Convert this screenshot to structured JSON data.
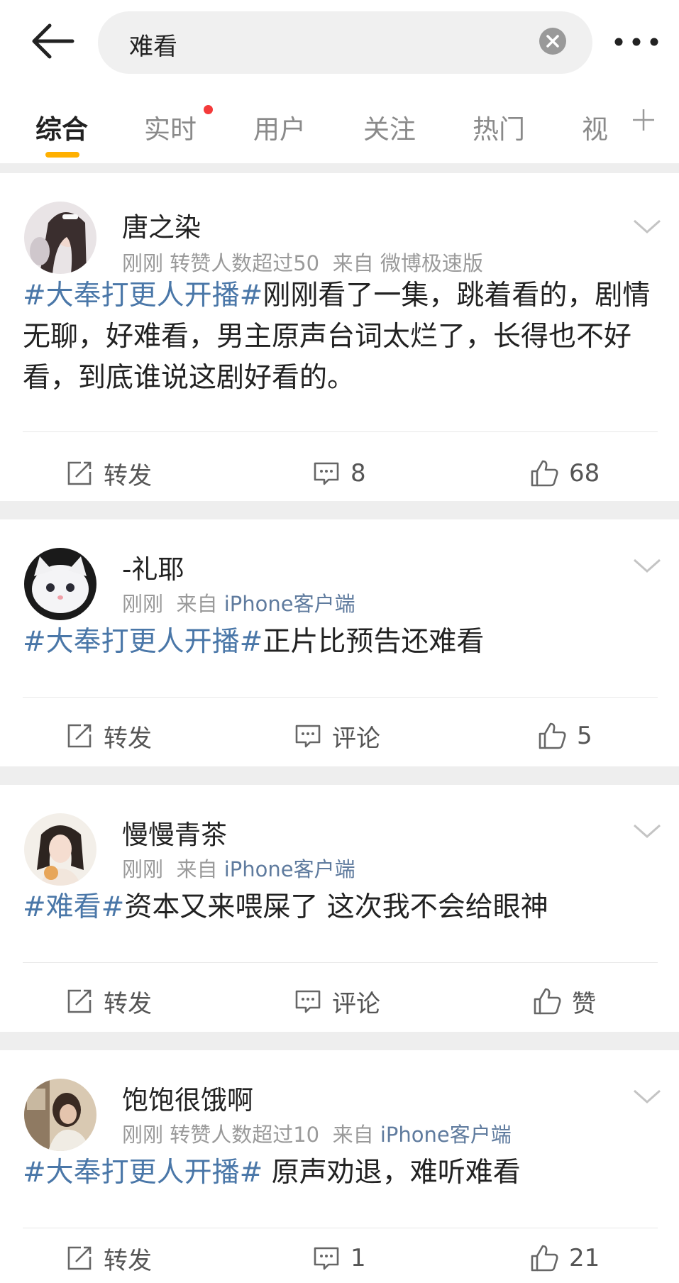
{
  "search": {
    "query": "难看"
  },
  "tabs": [
    {
      "label": "综合",
      "active": true
    },
    {
      "label": "实时",
      "has_dot": true
    },
    {
      "label": "用户"
    },
    {
      "label": "关注"
    },
    {
      "label": "热门"
    },
    {
      "label": "视"
    }
  ],
  "colors": {
    "accent": "#ffb000",
    "link": "#4a77a8",
    "dot": "#f43a3a"
  },
  "posts": [
    {
      "username": "唐之染",
      "time": "刚刚",
      "extra": "转赞人数超过50",
      "from_label": "来自",
      "source": "微博极速版",
      "tag": "#大奉打更人开播#",
      "text": "刚刚看了一集，跳着看的，剧情无聊，好难看，男主原声台词太烂了，长得也不好看，到底谁说这剧好看的。",
      "repost": "转发",
      "comment": "8",
      "like": "68"
    },
    {
      "username": "-礼耶",
      "time": "刚刚",
      "extra": "",
      "from_label": "来自",
      "source": "iPhone客户端",
      "tag": "#大奉打更人开播#",
      "text": "正片比预告还难看",
      "repost": "转发",
      "comment": "评论",
      "like": "5"
    },
    {
      "username": "慢慢青茶",
      "time": "刚刚",
      "extra": "",
      "from_label": "来自",
      "source": "iPhone客户端",
      "tag": "#难看#",
      "text": "资本又来喂屎了 这次我不会给眼神",
      "repost": "转发",
      "comment": "评论",
      "like": "赞"
    },
    {
      "username": "饱饱很饿啊",
      "time": "刚刚",
      "extra": "转赞人数超过10",
      "from_label": "来自",
      "source": "iPhone客户端",
      "tag": "#大奉打更人开播#",
      "text": " 原声劝退，难听难看",
      "repost": "转发",
      "comment": "1",
      "like": "21"
    }
  ]
}
